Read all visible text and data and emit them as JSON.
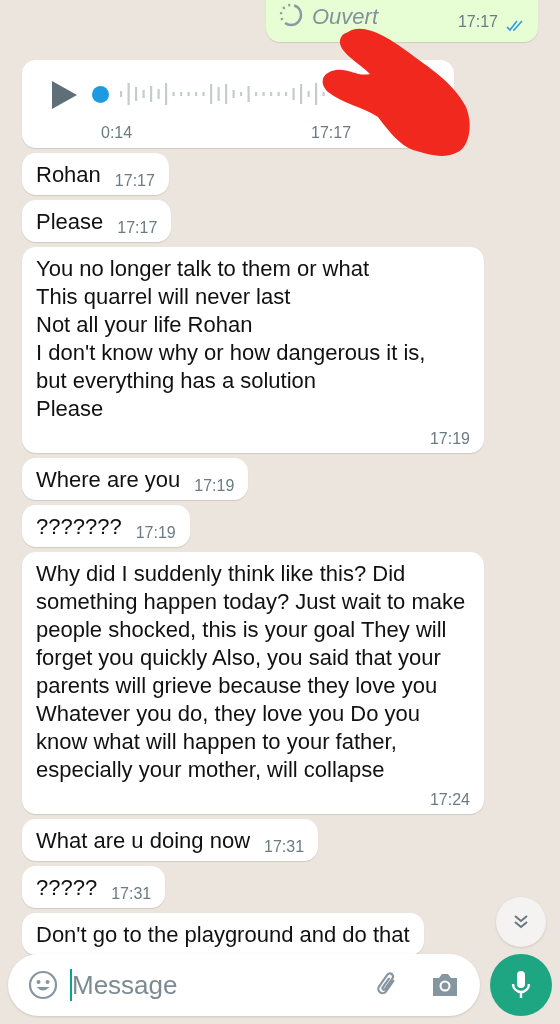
{
  "messages": [
    {
      "kind": "view_once",
      "outgoing": true,
      "text": "Ouvert",
      "time": "17:17",
      "read": true
    },
    {
      "kind": "voice",
      "outgoing": false,
      "duration": "0:14",
      "time": "17:17"
    },
    {
      "kind": "text",
      "outgoing": false,
      "text": "Rohan",
      "time": "17:17"
    },
    {
      "kind": "text",
      "outgoing": false,
      "text": "Please",
      "time": "17:17"
    },
    {
      "kind": "text",
      "outgoing": false,
      "text": "You no longer talk to them or what\nThis quarrel will never last\nNot all your life Rohan\nI don't know why or how dangerous it is,\nbut everything has a solution\nPlease",
      "time": "17:19"
    },
    {
      "kind": "text",
      "outgoing": false,
      "text": "Where are you",
      "time": "17:19"
    },
    {
      "kind": "text",
      "outgoing": false,
      "text": "???????",
      "time": "17:19"
    },
    {
      "kind": "text",
      "outgoing": false,
      "text": "Why did I suddenly think like this? Did something happen today? Just wait to make people shocked, this is your goal They will forget you quickly Also, you said that your parents will grieve because they love you Whatever you do, they love you Do you know what will happen to your father, especially your mother, will collapse",
      "time": "17:24"
    },
    {
      "kind": "text",
      "outgoing": false,
      "text": "What are u doing now",
      "time": "17:31"
    },
    {
      "kind": "text",
      "outgoing": false,
      "text": "?????",
      "time": "17:31"
    },
    {
      "kind": "text",
      "outgoing": false,
      "text": "Don't go to the playground and do that"
    }
  ],
  "composer": {
    "placeholder": "Message"
  }
}
